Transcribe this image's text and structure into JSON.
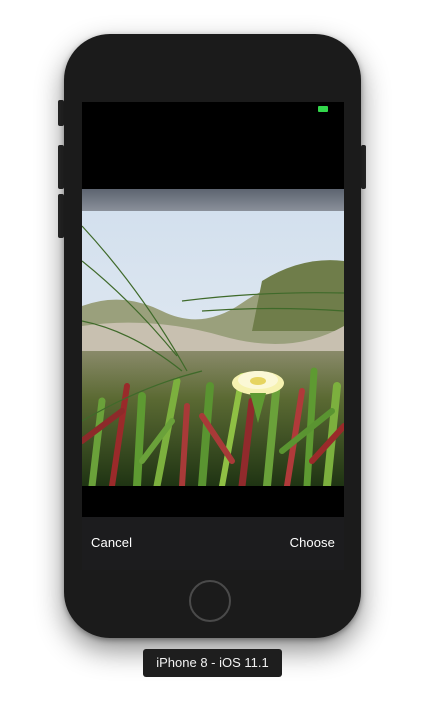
{
  "picker": {
    "cancel_label": "Cancel",
    "choose_label": "Choose"
  },
  "device": {
    "label": "iPhone 8 - iOS 11.1"
  },
  "colors": {
    "battery": "#32d74b",
    "phone_body": "#1b1b1b",
    "toolbar": "#1c1c1e"
  },
  "icons": {
    "home": "home-button-icon",
    "battery": "battery-icon"
  }
}
